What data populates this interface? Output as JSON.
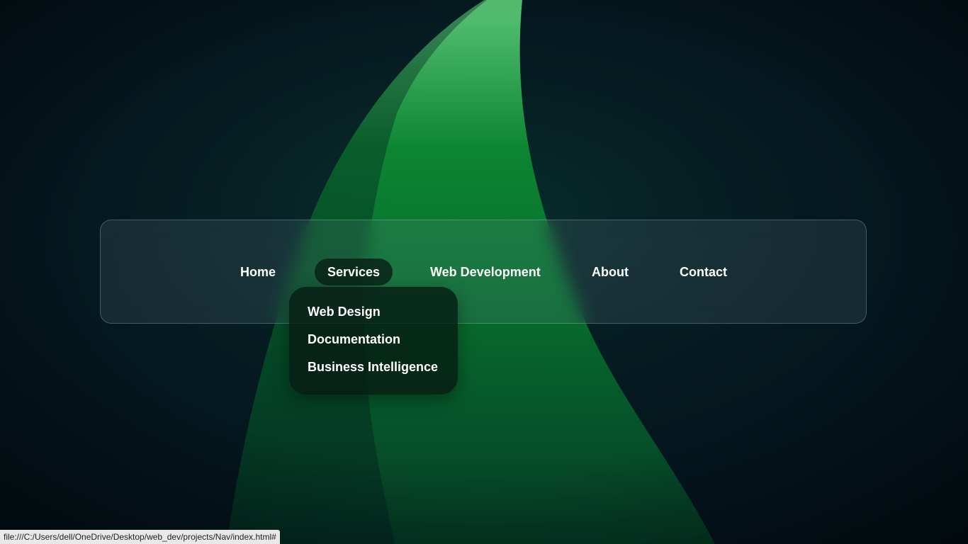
{
  "nav": {
    "items": [
      {
        "label": "Home"
      },
      {
        "label": "Services"
      },
      {
        "label": "Web Development"
      },
      {
        "label": "About"
      },
      {
        "label": "Contact"
      }
    ],
    "active": "Services"
  },
  "dropdown": {
    "items": [
      {
        "label": "Web Design"
      },
      {
        "label": "Documentation"
      },
      {
        "label": "Business Intelligence"
      }
    ]
  },
  "statusbar": {
    "url": "file:///C:/Users/dell/OneDrive/Desktop/web_dev/projects/Nav/index.html#"
  },
  "colors": {
    "background": "#03141c",
    "accent_green": "#0a8a34",
    "highlight_green": "#5fd07a"
  }
}
